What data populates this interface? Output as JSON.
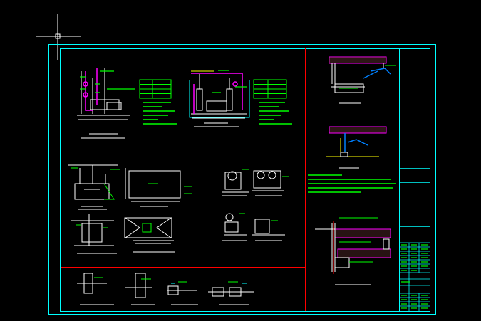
{
  "window": {
    "title": ""
  },
  "colors": {
    "background": "#000000",
    "frame": "#00ffff",
    "divider": "#ff0000",
    "note_text": "#00ff00",
    "geometry": "#ffffff",
    "highlight": "#ff00ff",
    "dimension": "#ffff00",
    "accent_blue": "#0080ff"
  },
  "cursor": {
    "icon": "crosshair-icon"
  },
  "sheet": {
    "description_lines_count": 0
  }
}
